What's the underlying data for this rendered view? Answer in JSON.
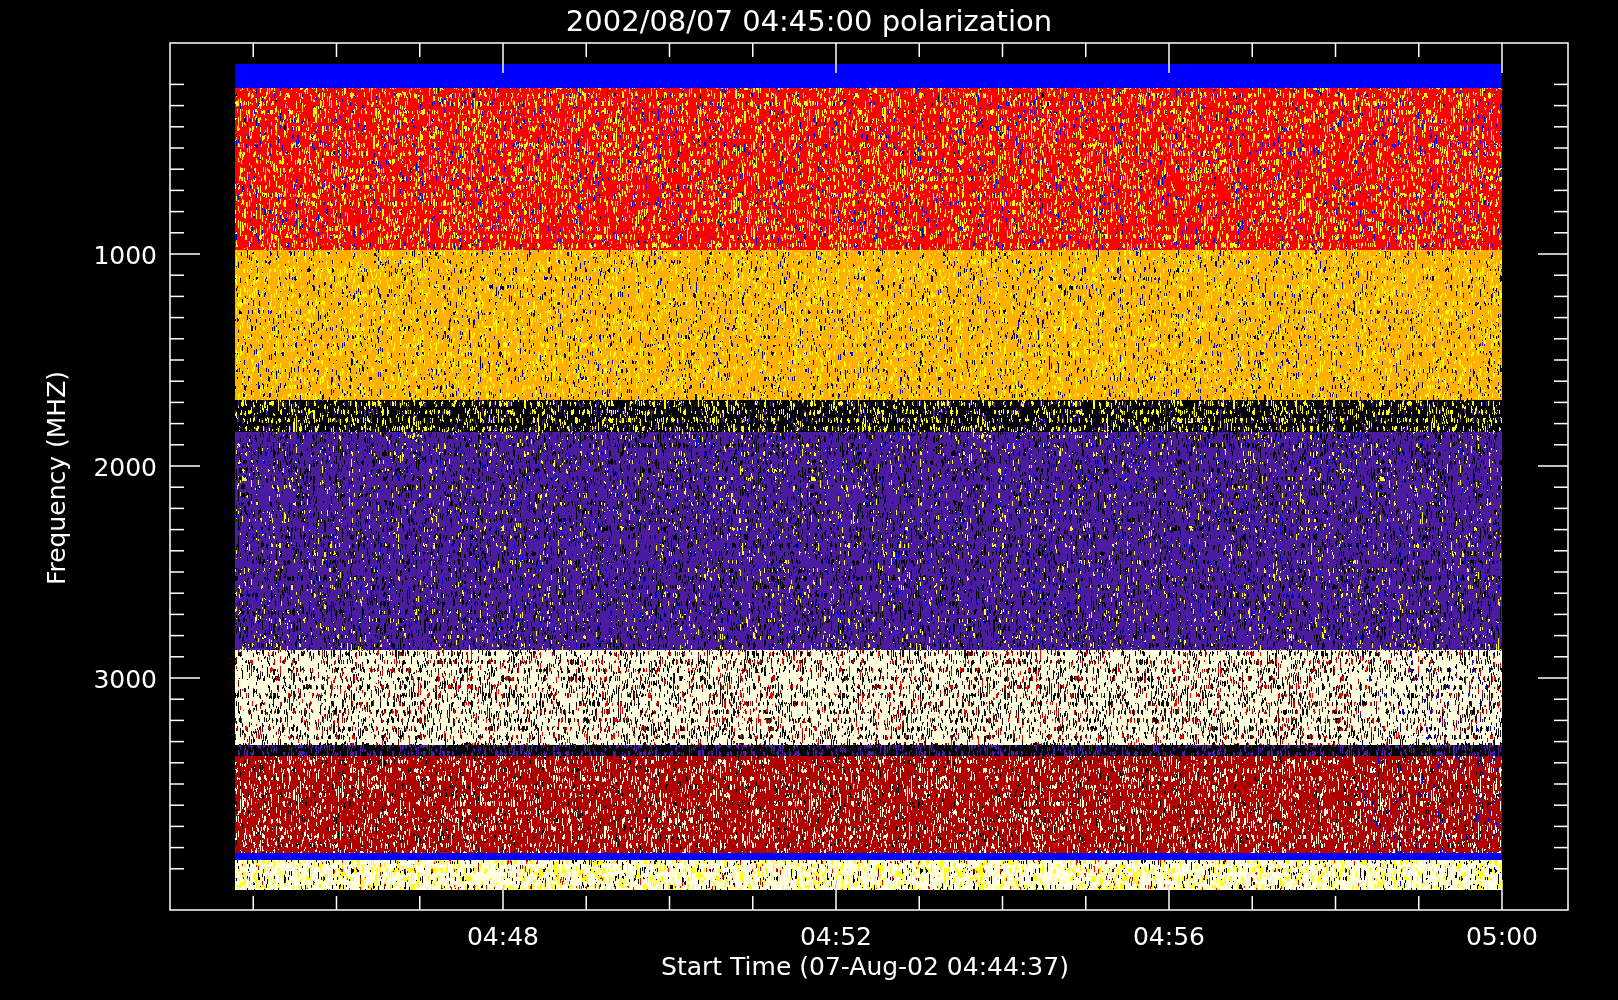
{
  "title": "2002/08/07 04:45:00 polarization",
  "y_axis": {
    "label": "Frequency (MHZ)",
    "ticks": [
      "1000",
      "2000",
      "3000"
    ]
  },
  "x_axis": {
    "label": "Start Time (07-Aug-02 04:44:37)",
    "ticks": [
      "04:48",
      "04:52",
      "04:56",
      "05:00"
    ]
  }
}
